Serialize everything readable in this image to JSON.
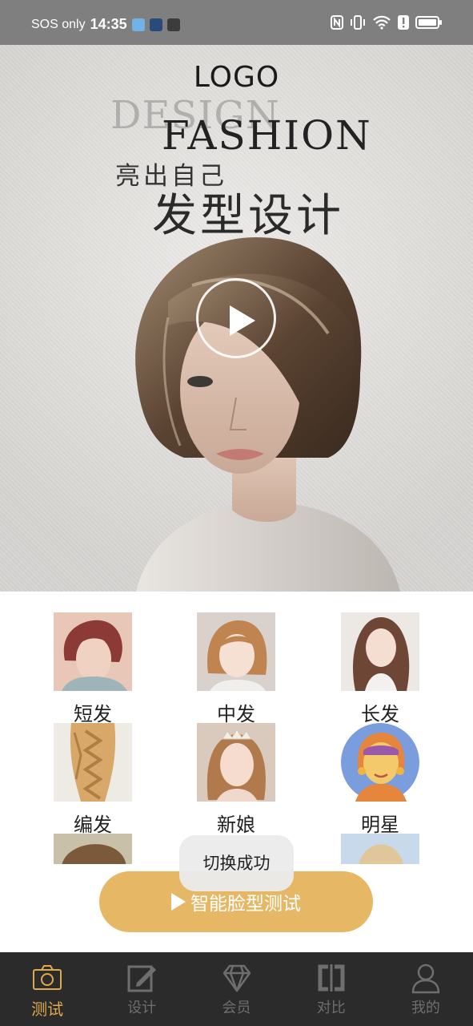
{
  "status_bar": {
    "carrier": "SOS only",
    "time": "14:35",
    "icons": [
      "app-notification-icon",
      "location-app-icon",
      "user-app-icon",
      "nfc-icon",
      "vibrate-icon",
      "wifi-icon",
      "alert-icon",
      "battery-icon"
    ]
  },
  "hero": {
    "logo": "LOGO",
    "watermark": "DESIGN",
    "headline": "FASHION",
    "slogan_line1": "亮出自己",
    "slogan_line2": "发型设计",
    "play_icon": "play-icon"
  },
  "hairstyles": [
    {
      "label": "短发"
    },
    {
      "label": "中发"
    },
    {
      "label": "长发"
    },
    {
      "label": "编发"
    },
    {
      "label": "新娘"
    },
    {
      "label": "明星"
    }
  ],
  "toast": "切换成功",
  "cta": {
    "label": "智能脸型测试",
    "icon": "play-icon"
  },
  "tabs": [
    {
      "label": "测试",
      "icon": "camera-icon",
      "active": true
    },
    {
      "label": "设计",
      "icon": "edit-icon",
      "active": false
    },
    {
      "label": "会员",
      "icon": "diamond-icon",
      "active": false
    },
    {
      "label": "对比",
      "icon": "compare-icon",
      "active": false
    },
    {
      "label": "我的",
      "icon": "user-icon",
      "active": false
    }
  ],
  "colors": {
    "status_bar": "#7f7f7f",
    "accent": "#e6b866",
    "tab_active": "#e0a94c",
    "tab_inactive": "#6e6e6e",
    "tabbar_bg": "#2b2b2b"
  }
}
